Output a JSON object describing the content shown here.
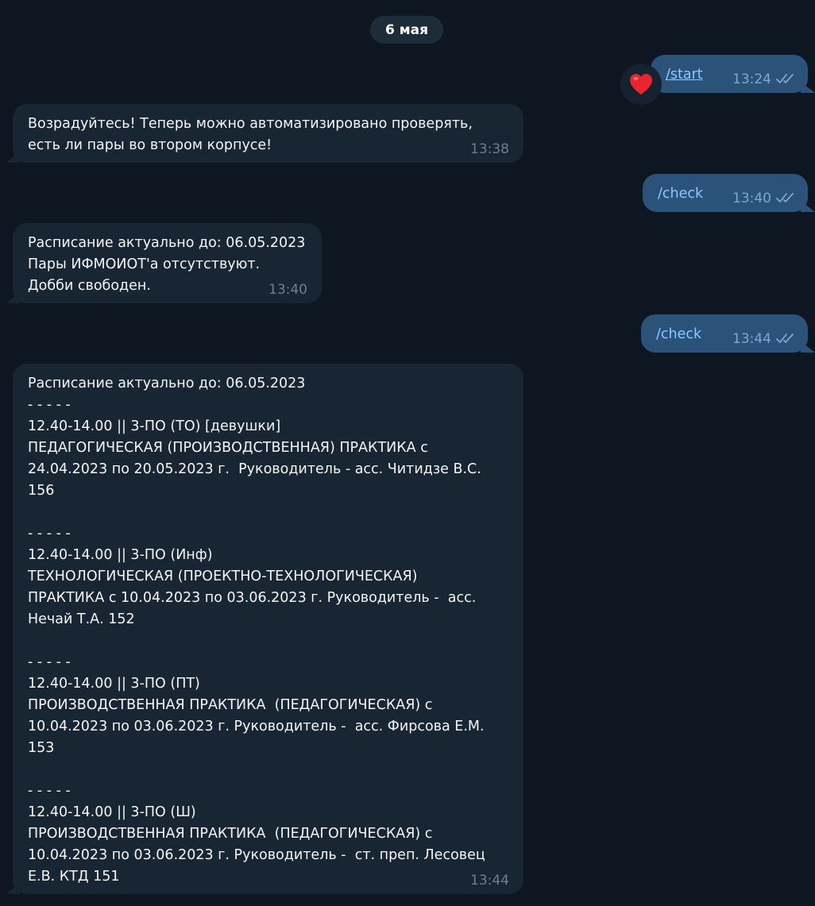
{
  "date_label": "6 мая",
  "messages": [
    {
      "type": "out",
      "text": "/start",
      "time": "13:24",
      "reaction": "heart-reaction"
    },
    {
      "type": "in",
      "text": "Возрадуйтесь! Теперь можно автоматизировано проверять,\nесть ли пары во втором корпусе!",
      "time": "13:38"
    },
    {
      "type": "out",
      "text": "/check",
      "time": "13:40"
    },
    {
      "type": "in",
      "text": "Расписание актуально до: 06.05.2023\nПары ИФМОИОТ'а отсутствуют.\nДобби свободен.",
      "time": "13:40"
    },
    {
      "type": "out",
      "text": "/check",
      "time": "13:44"
    },
    {
      "type": "in",
      "text": "Расписание актуально до: 06.05.2023\n- - - - -\n12.40-14.00 || 3-ПО (ТО) [девушки]\nПЕДАГОГИЧЕСКАЯ (ПРОИЗВОДСТВЕННАЯ) ПРАКТИКА с\n24.04.2023 по 20.05.2023 г.  Руководитель - асс. Читидзе В.С.\n156\n\n- - - - -\n12.40-14.00 || 3-ПО (Инф)\nТЕХНОЛОГИЧЕСКАЯ (ПРОЕКТНО-ТЕХНОЛОГИЧЕСКАЯ)\nПРАКТИКА с 10.04.2023 по 03.06.2023 г. Руководитель -  асс.\nНечай Т.А. 152\n\n- - - - -\n12.40-14.00 || 3-ПО (ПТ)\nПРОИЗВОДСТВЕННАЯ ПРАКТИКА  (ПЕДАГОГИЧЕСКАЯ) с\n10.04.2023 по 03.06.2023 г. Руководитель -  асс. Фирсова Е.М.\n153\n\n- - - - -\n12.40-14.00 || 3-ПО (Ш)\nПРОИЗВОДСТВЕННАЯ ПРАКТИКА  (ПЕДАГОГИЧЕСКАЯ) с\n10.04.2023 по 03.06.2023 г. Руководитель -  ст. преп. Лесовец\nЕ.В. КТД 151",
      "time": "13:44"
    }
  ],
  "colors": {
    "background": "#0e1621",
    "incoming_bubble": "#182533",
    "outgoing_bubble": "#2b5278",
    "command_text": "#8fc7ff",
    "read_checks": "#7da8d3"
  },
  "icons": {
    "read_status": "double-check-icon",
    "reaction": "heart-icon"
  }
}
